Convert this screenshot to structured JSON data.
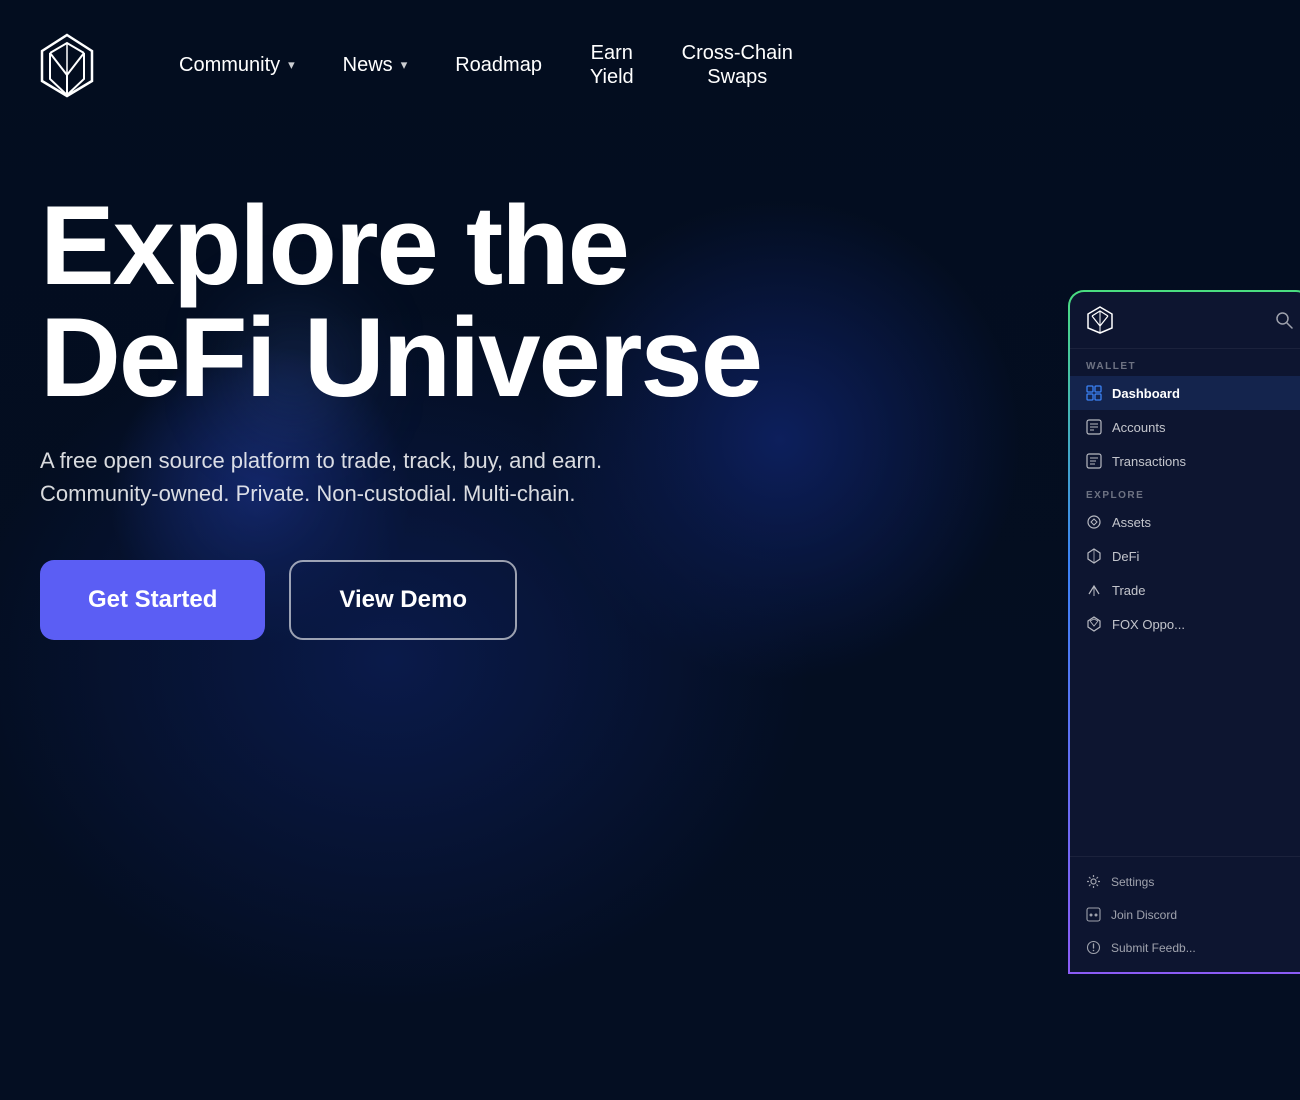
{
  "nav": {
    "logo_alt": "ShapeShift Fox Logo",
    "items": [
      {
        "label": "Community",
        "has_dropdown": true,
        "id": "community"
      },
      {
        "label": "News",
        "has_dropdown": true,
        "id": "news"
      },
      {
        "label": "Roadmap",
        "has_dropdown": false,
        "id": "roadmap"
      },
      {
        "label": "Earn\nYield",
        "has_dropdown": false,
        "id": "earn-yield"
      },
      {
        "label": "Cross-Chain\nSwaps",
        "has_dropdown": false,
        "id": "cross-chain-swaps"
      }
    ]
  },
  "hero": {
    "title_line1": "Explore the",
    "title_line2": "DeFi Universe",
    "subtitle": "A free open source platform to trade, track, buy, and earn. Community-owned. Private. Non-custodial. Multi-chain.",
    "btn_primary": "Get Started",
    "btn_secondary": "View Demo"
  },
  "app_panel": {
    "wallet_label": "WALLET",
    "explore_label": "EXPLORE",
    "menu_wallet": [
      {
        "label": "Dashboard",
        "active": true
      },
      {
        "label": "Accounts",
        "active": false
      },
      {
        "label": "Transactions",
        "active": false
      }
    ],
    "menu_explore": [
      {
        "label": "Assets",
        "active": false
      },
      {
        "label": "DeFi",
        "active": false
      },
      {
        "label": "Trade",
        "active": false
      },
      {
        "label": "FOX Oppo...",
        "active": false
      }
    ],
    "menu_bottom": [
      {
        "label": "Settings"
      },
      {
        "label": "Join Discord"
      },
      {
        "label": "Submit Feedb..."
      }
    ]
  }
}
